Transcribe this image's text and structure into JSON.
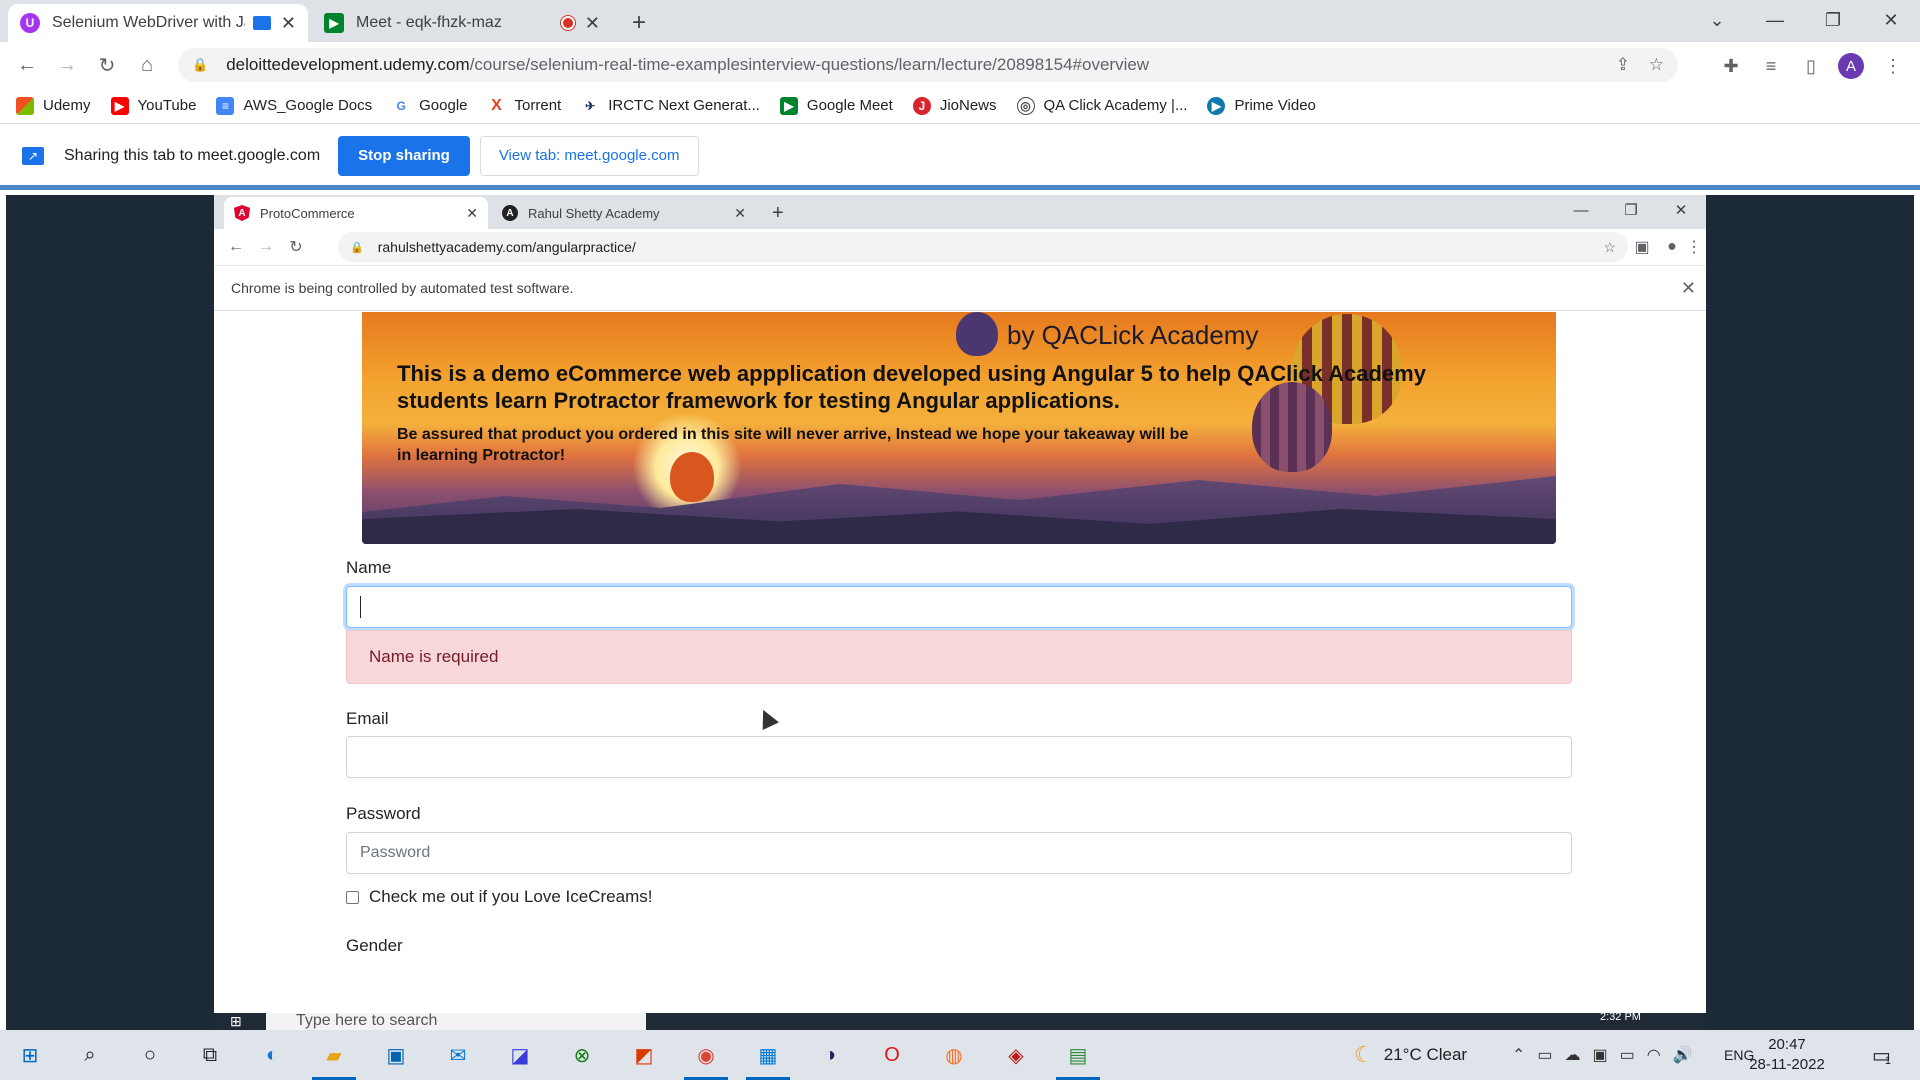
{
  "browser": {
    "tabs": [
      {
        "title": "Selenium WebDriver with Ja",
        "active": true
      },
      {
        "title": "Meet - eqk-fhzk-maz",
        "active": false
      }
    ],
    "url_host": "deloittedevelopment.udemy.com",
    "url_path": "/course/selenium-real-time-examplesinterview-questions/learn/lecture/20898154#overview",
    "profile_initial": "A",
    "bookmarks": [
      "Udemy",
      "YouTube",
      "AWS_Google Docs",
      "Google",
      "Torrent",
      "IRCTC Next Generat...",
      "Google Meet",
      "JioNews",
      "QA Click Academy |...",
      "Prime Video"
    ]
  },
  "share_bar": {
    "message": "Sharing this tab to meet.google.com",
    "stop_label": "Stop sharing",
    "view_label": "View tab: meet.google.com"
  },
  "inner_browser": {
    "tabs": [
      {
        "title": "ProtoCommerce",
        "active": true
      },
      {
        "title": "Rahul Shetty Academy",
        "active": false
      }
    ],
    "url": "rahulshettyacademy.com/angularpractice/",
    "infobar": "Chrome is being controlled by automated test software."
  },
  "page": {
    "banner_byline": "by QACLick Academy",
    "banner_desc": "This is a demo eCommerce web appplication developed using Angular 5 to help QAClick Academy students learn Protractor framework for testing Angular applications.",
    "banner_desc2": "Be assured that product you ordered in this site will never arrive, Instead we hope your takeaway will be in learning Protractor!",
    "name_label": "Name",
    "name_value": "",
    "name_error": "Name is required",
    "email_label": "Email",
    "email_value": "",
    "password_label": "Password",
    "password_placeholder": "Password",
    "checkbox_label": "Check me out if you Love IceCreams!",
    "checkbox_checked": false,
    "gender_label": "Gender"
  },
  "inner_taskbar": {
    "search_placeholder": "Type here to search",
    "clock": "2:32 PM"
  },
  "taskbar": {
    "weather": "21°C  Clear",
    "language": "ENG",
    "time": "20:47",
    "date": "28-11-2022",
    "notification_count": "1"
  }
}
